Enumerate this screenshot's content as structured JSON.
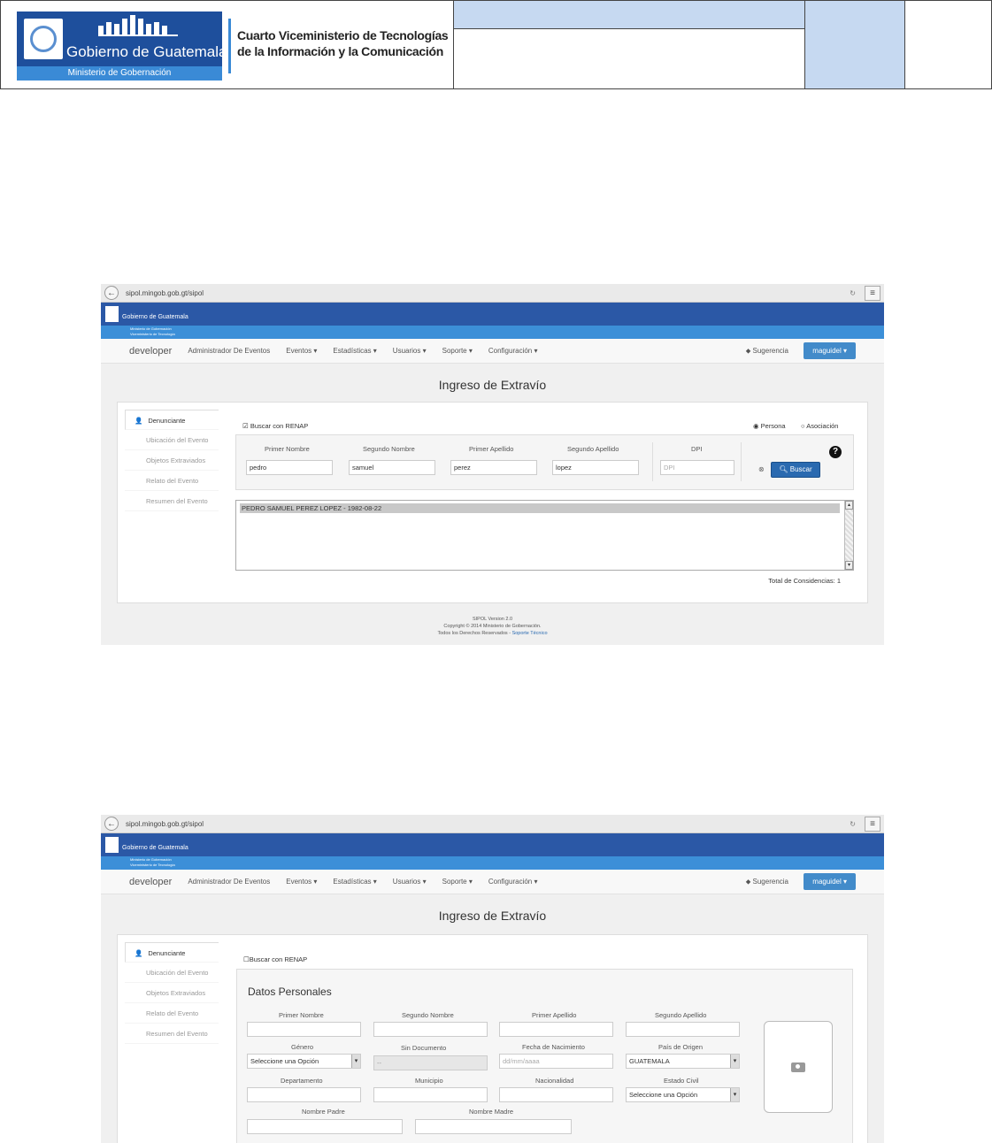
{
  "doc_header": {
    "logo_name": "Gobierno de Guatemala",
    "logo_ministry": "Ministerio de Gobernación",
    "vice_line1": "Cuarto Viceministerio de Tecnologías",
    "vice_line2": "de la Información y la Comunicación"
  },
  "browser": {
    "url": "sipol.mingob.gob.gt/sipol",
    "reload_icon": "↻",
    "back_icon": "←",
    "menu_icon": "≡"
  },
  "banner": {
    "title": "Gobierno de Guatemala",
    "line1": "Ministerio de Gobernación",
    "line2": "Viceministerio de Tecnología"
  },
  "nav": {
    "brand": "developer",
    "items": [
      "Administrador De Eventos",
      "Eventos ▾",
      "Estadísticas ▾",
      "Usuarios ▾",
      "Soporte ▾",
      "Configuración ▾"
    ],
    "sugerencia": "Sugerencia",
    "user": "maguidel ▾"
  },
  "page_title": "Ingreso de Extravío",
  "sidebar": [
    "Denunciante",
    "Ubicación del Evento",
    "Objetos Extraviados",
    "Relato del Evento",
    "Resumen del Evento"
  ],
  "shot1": {
    "renap_label": "Buscar con RENAP",
    "radio_persona": "Persona",
    "radio_asociacion": "Asociación",
    "labels": [
      "Primer Nombre",
      "Segundo Nombre",
      "Primer Apellido",
      "Segundo Apellido",
      "DPI"
    ],
    "values": [
      "pedro",
      "samuel",
      "perez",
      "lopez"
    ],
    "dpi_placeholder": "DPI",
    "buscar": "Buscar",
    "result": "PEDRO SAMUEL PEREZ LOPEZ - 1982-08-22",
    "total": "Total de Considencias: 1"
  },
  "footer": {
    "version": "SIPOL Version 2.0",
    "copyright": "Copyright © 2014 Ministerio de Gobernación.",
    "rights": "Todos los Derechos Reservados -",
    "support": "Soporte Técnico"
  },
  "shot2": {
    "renap_label": "Buscar con RENAP",
    "section_title": "Datos Personales",
    "row1": [
      "Primer Nombre",
      "Segundo Nombre",
      "Primer Apellido",
      "Segundo Apellido"
    ],
    "row2": [
      "Género",
      "Sin Documento",
      "Fecha de Nacimiento",
      "País de Origen"
    ],
    "genero_value": "Seleccione una Opción",
    "sindoc_value": "--",
    "fecha_placeholder": "dd/mm/aaaa",
    "pais_value": "GUATEMALA",
    "row3": [
      "Departamento",
      "Municipio",
      "Nacionalidad",
      "Estado Civil"
    ],
    "estado_value": "Seleccione una Opción",
    "row4": [
      "Nombre Padre",
      "Nombre Madre"
    ]
  }
}
